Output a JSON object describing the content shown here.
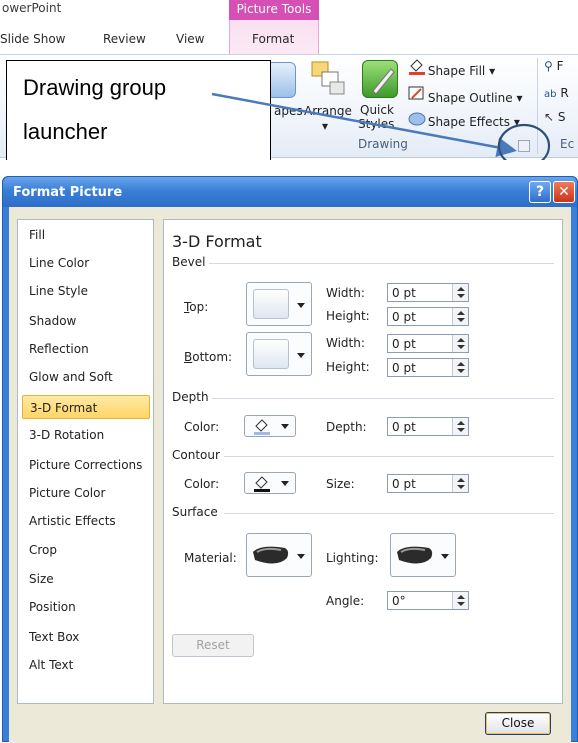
{
  "ribbon": {
    "app_title": "owerPoint",
    "context_header": "Picture Tools",
    "tabs": [
      "Slide Show",
      "Review",
      "View",
      "Format"
    ],
    "buttons": {
      "shapes_partial": "apes",
      "arrange": "Arrange",
      "quick_styles_1": "Quick",
      "quick_styles_2": "Styles",
      "shape_fill": "Shape Fill",
      "shape_outline": "Shape Outline",
      "shape_effects": "Shape Effects"
    },
    "drawing_group_label": "Drawing",
    "right_partial": {
      "a": "F",
      "b": "R",
      "c": "S",
      "d": "Ec"
    },
    "dropdown_caret": "▾"
  },
  "callout": {
    "line1": "Drawing group",
    "line2": "launcher"
  },
  "dialog": {
    "title": "Format Picture",
    "help_glyph": "?",
    "close_glyph": "✕",
    "nav": [
      "Fill",
      "Line Color",
      "Line Style",
      "Shadow",
      "Reflection",
      "Glow and Soft Edges",
      "3-D Format",
      "3-D Rotation",
      "Picture Corrections",
      "Picture Color",
      "Artistic Effects",
      "Crop",
      "Size",
      "Position",
      "Text Box",
      "Alt Text"
    ],
    "selected_nav": "3-D Format",
    "panel": {
      "title": "3-D Format",
      "bevel": {
        "label": "Bevel",
        "top_label": "Top:",
        "bottom_label": "Bottom:",
        "width_label": "Width:",
        "height_label": "Height:",
        "top_width": "0 pt",
        "top_height": "0 pt",
        "bottom_width": "0 pt",
        "bottom_height": "0 pt"
      },
      "depth": {
        "label": "Depth",
        "color_label": "Color:",
        "depth_label": "Depth:",
        "depth_value": "0 pt"
      },
      "contour": {
        "label": "Contour",
        "color_label": "Color:",
        "size_label": "Size:",
        "size_value": "0 pt"
      },
      "surface": {
        "label": "Surface",
        "material_label": "Material:",
        "lighting_label": "Lighting:",
        "angle_label": "Angle:",
        "angle_value": "0°"
      },
      "reset_label": "Reset"
    },
    "close_label": "Close"
  },
  "colors": {
    "titlebar": "#3a7fd6",
    "context_tab": "#d64fb5",
    "selection": "#ffd568",
    "callout_arrow": "#4a7ab8",
    "launcher_circle": "#2f4f7a"
  },
  "icons": [
    "shape-fill-icon",
    "shape-outline-icon",
    "shape-effects-icon",
    "find-icon",
    "replace-icon",
    "select-icon",
    "help-icon",
    "close-icon",
    "paint-bucket-icon",
    "material-icon",
    "lighting-icon",
    "bevel-swatch-icon",
    "spinner-icon",
    "dropdown-arrow-icon",
    "dialog-launcher-icon"
  ]
}
